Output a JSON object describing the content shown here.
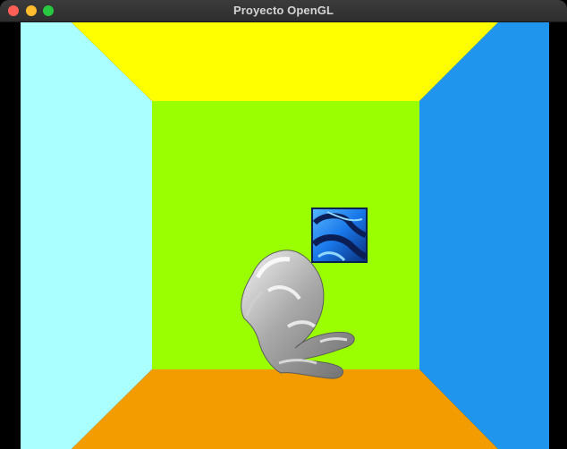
{
  "window": {
    "title": "Proyecto OpenGL",
    "buttons": {
      "close_color": "#ff5f57",
      "minimize_color": "#febc2e",
      "zoom_color": "#28c840"
    }
  },
  "scene": {
    "colors": {
      "background": "#000000",
      "left_wall": "#aaffff",
      "ceiling": "#ffff00",
      "right_wall": "#1f95ee",
      "back_wall": "#9aff00",
      "floor": "#f39c00"
    },
    "objects": [
      "textured-cube",
      "gray-3d-model"
    ]
  }
}
